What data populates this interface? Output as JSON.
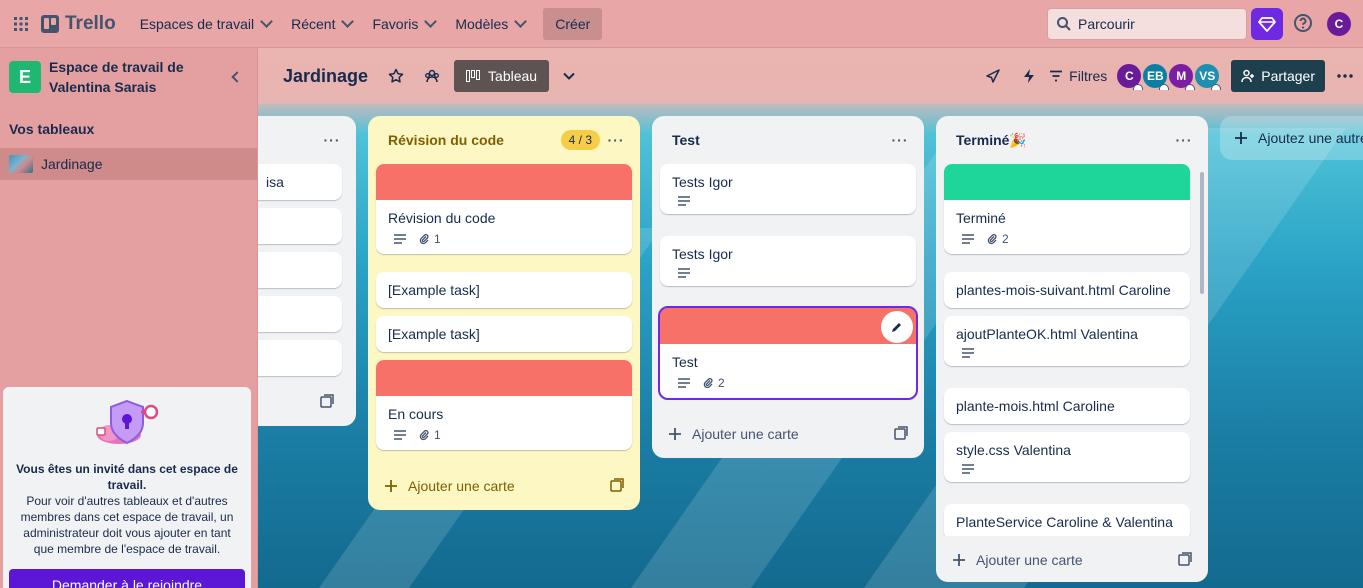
{
  "topbar": {
    "app_name": "Trello",
    "nav": [
      {
        "label": "Espaces de travail"
      },
      {
        "label": "Récent"
      },
      {
        "label": "Favoris"
      },
      {
        "label": "Modèles"
      }
    ],
    "create_label": "Créer",
    "search_placeholder": "Parcourir",
    "avatar_initial": "C",
    "icons": {
      "apps": "grid-icon",
      "premium": "diamond-icon",
      "help": "help-icon"
    }
  },
  "sidebar": {
    "workspace_initial": "E",
    "workspace_name": "Espace de travail de Valentina Sarais",
    "boards_heading": "Vos tableaux",
    "boards": [
      {
        "label": "Jardinage"
      }
    ],
    "guest_title": "Vous êtes un invité dans cet espace de travail.",
    "guest_text": "Pour voir d'autres tableaux et d'autres membres dans cet espace de travail, un administrateur doit vous ajouter en tant que membre de l'espace de travail.",
    "join_label": "Demander à le rejoindre"
  },
  "board": {
    "title": "Jardinage",
    "view_label": "Tableau",
    "filter_label": "Filtres",
    "share_label": "Partager",
    "members": [
      {
        "initials": "C",
        "color": "#6a1b9a"
      },
      {
        "initials": "EB",
        "color": "#0c7fa0"
      },
      {
        "initials": "M",
        "color": "#7b1fa2"
      },
      {
        "initials": "VS",
        "color": "#1f8fb0"
      }
    ]
  },
  "lists": {
    "first": {
      "cards": [
        {
          "title": "isa"
        },
        {
          "title": ""
        },
        {
          "title": ""
        },
        {
          "title": ""
        },
        {
          "title": ""
        }
      ]
    },
    "review": {
      "title": "Révision du code",
      "count": "4 / 3",
      "cards": [
        {
          "title": "Révision du code",
          "cover": "#f87168",
          "attachments": "1"
        },
        {
          "title": "[Example task]"
        },
        {
          "title": "[Example task]"
        },
        {
          "title": "En cours",
          "cover": "#f87168",
          "attachments": "1"
        }
      ],
      "add_label": "Ajouter une carte"
    },
    "test": {
      "title": "Test",
      "cards": [
        {
          "title": "Tests Igor"
        },
        {
          "title": "Tests Igor"
        },
        {
          "title": "Test",
          "cover": "#f87168",
          "attachments": "2"
        }
      ],
      "add_label": "Ajouter une carte"
    },
    "done": {
      "title": "Terminé🎉",
      "cards": [
        {
          "title": "Terminé",
          "cover": "#1fd69a",
          "attachments": "2"
        },
        {
          "title": "plantes-mois-suivant.html Caroline"
        },
        {
          "title": "ajoutPlanteOK.html Valentina"
        },
        {
          "title": "plante-mois.html Caroline"
        },
        {
          "title": "style.css Valentina"
        },
        {
          "title": "PlanteService Caroline & Valentina"
        }
      ],
      "add_label": "Ajouter une carte"
    },
    "add_list_label": "Ajoutez une autre"
  }
}
